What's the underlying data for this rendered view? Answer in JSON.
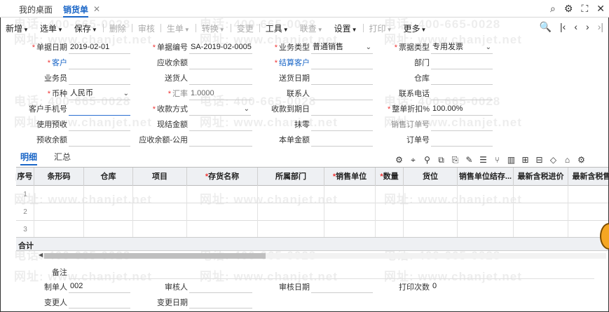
{
  "tabs": {
    "desktop": "我的桌面",
    "sales": "销货单",
    "close": "✕"
  },
  "toolbar": {
    "new": "新增",
    "select": "选单",
    "save": "保存",
    "delete": "删除",
    "audit": "审核",
    "generate": "生单",
    "convert": "转换",
    "change": "变更",
    "tools": "工具",
    "query": "联查",
    "settings": "设置",
    "print": "打印",
    "more": "更多"
  },
  "form": {
    "doc_date_label": "单据日期",
    "doc_date": "2019-02-01",
    "doc_no_label": "单据编号",
    "doc_no": "SA-2019-02-0005",
    "biz_type_label": "业务类型",
    "biz_type": "普通销售",
    "invoice_type_label": "票据类型",
    "invoice_type": "专用发票",
    "customer_label": "客户",
    "receivable_label": "应收余额",
    "settle_customer_label": "结算客户",
    "dept_label": "部门",
    "salesman_label": "业务员",
    "consignee_label": "送货人",
    "delivery_date_label": "送货日期",
    "warehouse_label": "仓库",
    "currency_label": "币种",
    "currency": "人民币",
    "rate_label": "汇率",
    "rate": "1.0000",
    "contact_label": "联系人",
    "phone_label": "联系电话",
    "mobile_label": "客户手机号",
    "pay_method_label": "收款方式",
    "due_date_label": "收款到期日",
    "discount_label": "整单折扣%",
    "discount": "100.00%",
    "use_prepay_label": "使用预收",
    "cash_label": "现结金额",
    "round_label": "抹零",
    "sales_order_label": "销售订单号",
    "prepay_balance_label": "预收余额",
    "receivable_public_label": "应收余额-公用",
    "amount_label": "本单金额",
    "order_no_label": "订单号"
  },
  "detail_tabs": {
    "detail": "明细",
    "summary": "汇总"
  },
  "table": {
    "columns": [
      "序号",
      "条形码",
      "仓库",
      "项目",
      "存货名称",
      "所属部门",
      "销售单位",
      "数量",
      "货位",
      "销售单位结存...",
      "最新含税进价",
      "最新含税售价"
    ],
    "required": [
      "存货名称",
      "销售单位",
      "数量"
    ],
    "rows": [
      "1",
      "2",
      "3"
    ],
    "total_label": "合计"
  },
  "footer": {
    "remark_label": "备注",
    "maker_label": "制单人",
    "maker": "002",
    "auditor_label": "审核人",
    "audit_date_label": "审核日期",
    "print_count_label": "打印次数",
    "print_count": "0",
    "changer_label": "变更人",
    "change_date_label": "变更日期"
  },
  "watermark": {
    "phone": "电话: 400-665-0028",
    "site": "网址: www.chanjet.net"
  },
  "colors": {
    "accent": "#1a66c7",
    "required": "#e33333"
  }
}
